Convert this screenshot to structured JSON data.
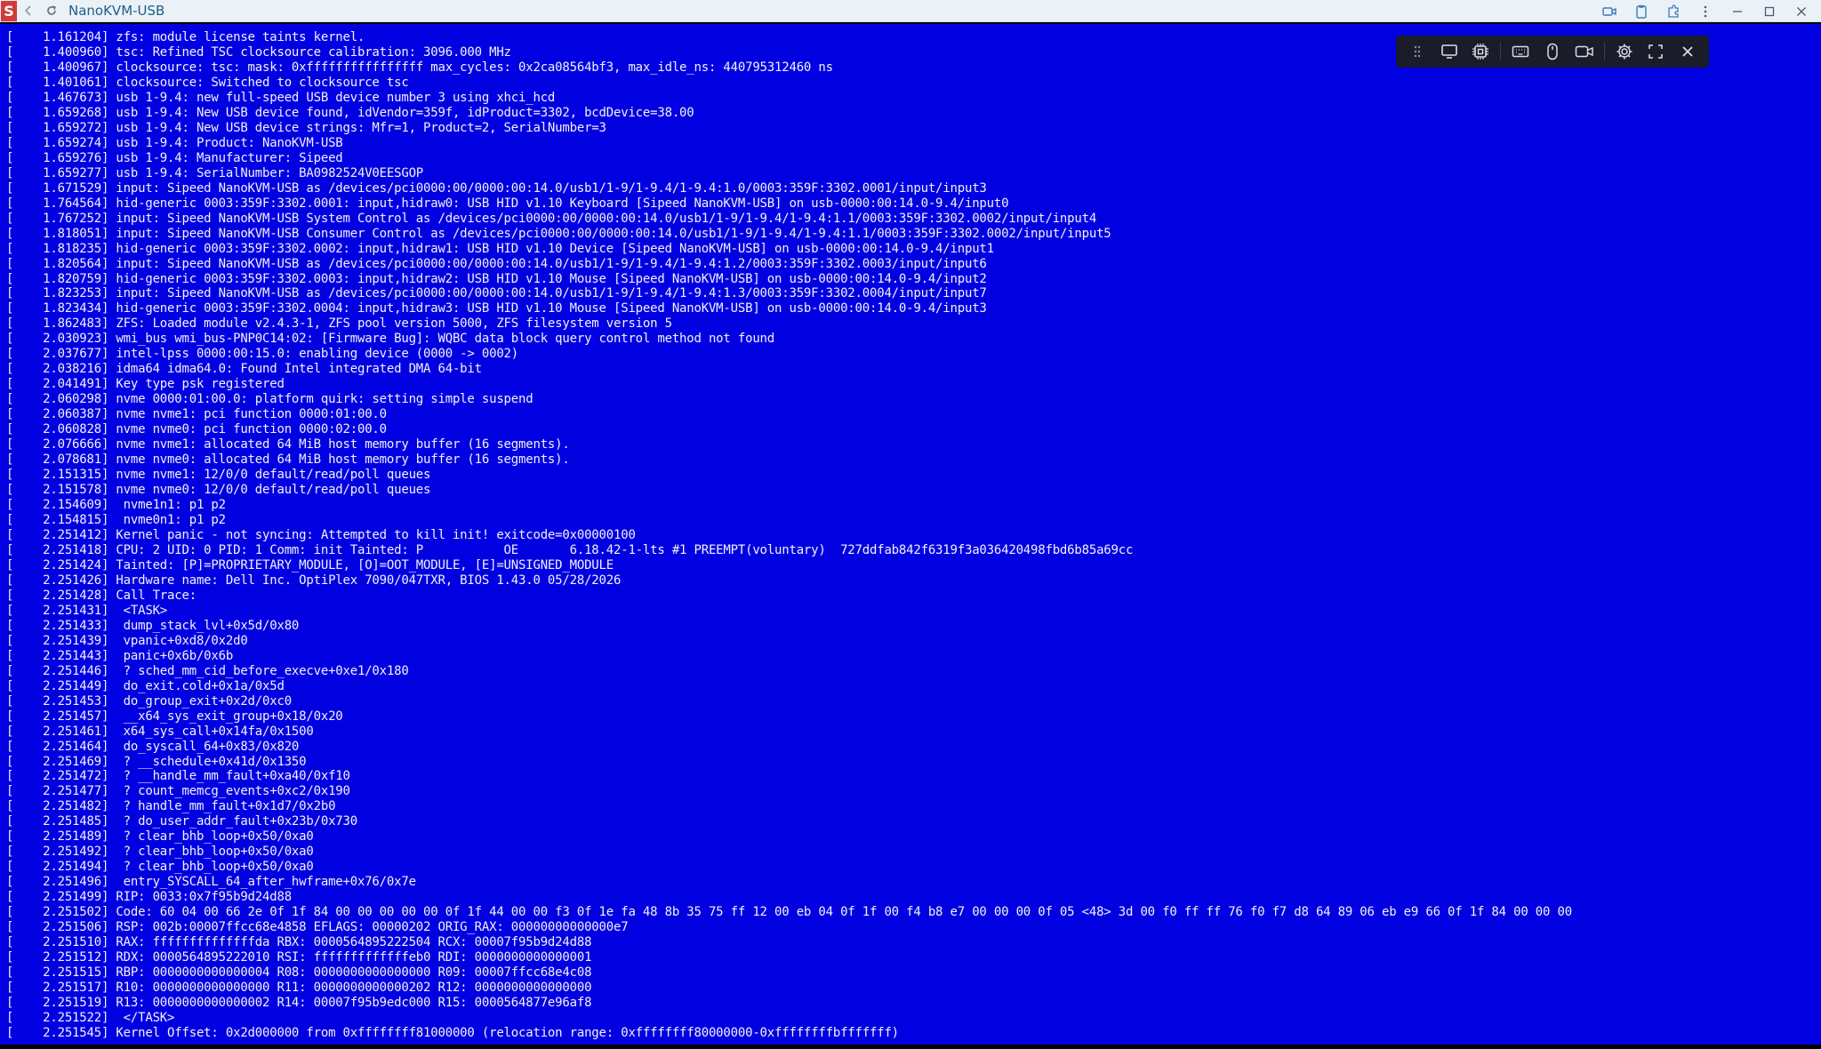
{
  "window": {
    "title": "NanoKVM-USB",
    "logo_letter": "S",
    "controls": [
      "back-icon",
      "refresh-icon"
    ],
    "right_controls": [
      "record-icon",
      "clipboard-icon",
      "extension-icon",
      "more-icon",
      "minimize-icon",
      "maximize-icon",
      "close-icon"
    ]
  },
  "toolbar": {
    "items": [
      "drag-handle-icon",
      "monitor-icon",
      "chip-icon",
      "keyboard-icon",
      "mouse-icon",
      "video-icon",
      "settings-icon",
      "fullscreen-icon",
      "close-icon"
    ]
  },
  "colors": {
    "console_bg": "#0000e0",
    "console_fg": "#f2f2ff",
    "titlebar_bg": "#eaf2f8",
    "toolbar_bg": "#1b1c2a"
  },
  "console": {
    "lines": [
      "[    1.161204] zfs: module license taints kernel.",
      "[    1.400960] tsc: Refined TSC clocksource calibration: 3096.000 MHz",
      "[    1.400967] clocksource: tsc: mask: 0xffffffffffffffff max_cycles: 0x2ca08564bf3, max_idle_ns: 440795312460 ns",
      "[    1.401061] clocksource: Switched to clocksource tsc",
      "[    1.467673] usb 1-9.4: new full-speed USB device number 3 using xhci_hcd",
      "[    1.659268] usb 1-9.4: New USB device found, idVendor=359f, idProduct=3302, bcdDevice=38.00",
      "[    1.659272] usb 1-9.4: New USB device strings: Mfr=1, Product=2, SerialNumber=3",
      "[    1.659274] usb 1-9.4: Product: NanoKVM-USB",
      "[    1.659276] usb 1-9.4: Manufacturer: Sipeed",
      "[    1.659277] usb 1-9.4: SerialNumber: BA0982524V0EESGOP",
      "[    1.671529] input: Sipeed NanoKVM-USB as /devices/pci0000:00/0000:00:14.0/usb1/1-9/1-9.4/1-9.4:1.0/0003:359F:3302.0001/input/input3",
      "[    1.764564] hid-generic 0003:359F:3302.0001: input,hidraw0: USB HID v1.10 Keyboard [Sipeed NanoKVM-USB] on usb-0000:00:14.0-9.4/input0",
      "[    1.767252] input: Sipeed NanoKVM-USB System Control as /devices/pci0000:00/0000:00:14.0/usb1/1-9/1-9.4/1-9.4:1.1/0003:359F:3302.0002/input/input4",
      "[    1.818051] input: Sipeed NanoKVM-USB Consumer Control as /devices/pci0000:00/0000:00:14.0/usb1/1-9/1-9.4/1-9.4:1.1/0003:359F:3302.0002/input/input5",
      "[    1.818235] hid-generic 0003:359F:3302.0002: input,hidraw1: USB HID v1.10 Device [Sipeed NanoKVM-USB] on usb-0000:00:14.0-9.4/input1",
      "[    1.820564] input: Sipeed NanoKVM-USB as /devices/pci0000:00/0000:00:14.0/usb1/1-9/1-9.4/1-9.4:1.2/0003:359F:3302.0003/input/input6",
      "[    1.820759] hid-generic 0003:359F:3302.0003: input,hidraw2: USB HID v1.10 Mouse [Sipeed NanoKVM-USB] on usb-0000:00:14.0-9.4/input2",
      "[    1.823253] input: Sipeed NanoKVM-USB as /devices/pci0000:00/0000:00:14.0/usb1/1-9/1-9.4/1-9.4:1.3/0003:359F:3302.0004/input/input7",
      "[    1.823434] hid-generic 0003:359F:3302.0004: input,hidraw3: USB HID v1.10 Mouse [Sipeed NanoKVM-USB] on usb-0000:00:14.0-9.4/input3",
      "[    1.862483] ZFS: Loaded module v2.4.3-1, ZFS pool version 5000, ZFS filesystem version 5",
      "[    2.030923] wmi_bus wmi_bus-PNP0C14:02: [Firmware Bug]: WQBC data block query control method not found",
      "[    2.037677] intel-lpss 0000:00:15.0: enabling device (0000 -> 0002)",
      "[    2.038216] idma64 idma64.0: Found Intel integrated DMA 64-bit",
      "[    2.041491] Key type psk registered",
      "[    2.060298] nvme 0000:01:00.0: platform quirk: setting simple suspend",
      "[    2.060387] nvme nvme1: pci function 0000:01:00.0",
      "[    2.060828] nvme nvme0: pci function 0000:02:00.0",
      "[    2.076666] nvme nvme1: allocated 64 MiB host memory buffer (16 segments).",
      "[    2.078681] nvme nvme0: allocated 64 MiB host memory buffer (16 segments).",
      "[    2.151315] nvme nvme1: 12/0/0 default/read/poll queues",
      "[    2.151578] nvme nvme0: 12/0/0 default/read/poll queues",
      "[    2.154609]  nvme1n1: p1 p2",
      "[    2.154815]  nvme0n1: p1 p2",
      "[    2.251412] Kernel panic - not syncing: Attempted to kill init! exitcode=0x00000100",
      "[    2.251418] CPU: 2 UID: 0 PID: 1 Comm: init Tainted: P           OE       6.18.42-1-lts #1 PREEMPT(voluntary)  727ddfab842f6319f3a036420498fbd6b85a69cc",
      "[    2.251424] Tainted: [P]=PROPRIETARY_MODULE, [O]=OOT_MODULE, [E]=UNSIGNED_MODULE",
      "[    2.251426] Hardware name: Dell Inc. OptiPlex 7090/047TXR, BIOS 1.43.0 05/28/2026",
      "[    2.251428] Call Trace:",
      "[    2.251431]  <TASK>",
      "[    2.251433]  dump_stack_lvl+0x5d/0x80",
      "[    2.251439]  vpanic+0xd8/0x2d0",
      "[    2.251443]  panic+0x6b/0x6b",
      "[    2.251446]  ? sched_mm_cid_before_execve+0xe1/0x180",
      "[    2.251449]  do_exit.cold+0x1a/0x5d",
      "[    2.251453]  do_group_exit+0x2d/0xc0",
      "[    2.251457]  __x64_sys_exit_group+0x18/0x20",
      "[    2.251461]  x64_sys_call+0x14fa/0x1500",
      "[    2.251464]  do_syscall_64+0x83/0x820",
      "[    2.251469]  ? __schedule+0x41d/0x1350",
      "[    2.251472]  ? __handle_mm_fault+0xa40/0xf10",
      "[    2.251477]  ? count_memcg_events+0xc2/0x190",
      "[    2.251482]  ? handle_mm_fault+0x1d7/0x2b0",
      "[    2.251485]  ? do_user_addr_fault+0x23b/0x730",
      "[    2.251489]  ? clear_bhb_loop+0x50/0xa0",
      "[    2.251492]  ? clear_bhb_loop+0x50/0xa0",
      "[    2.251494]  ? clear_bhb_loop+0x50/0xa0",
      "[    2.251496]  entry_SYSCALL_64_after_hwframe+0x76/0x7e",
      "[    2.251499] RIP: 0033:0x7f95b9d24d88",
      "[    2.251502] Code: 60 04 00 66 2e 0f 1f 84 00 00 00 00 00 0f 1f 44 00 00 f3 0f 1e fa 48 8b 35 75 ff 12 00 eb 04 0f 1f 00 f4 b8 e7 00 00 00 0f 05 <48> 3d 00 f0 ff ff 76 f0 f7 d8 64 89 06 eb e9 66 0f 1f 84 00 00 00",
      "[    2.251506] RSP: 002b:00007ffcc68e4858 EFLAGS: 00000202 ORIG_RAX: 00000000000000e7",
      "[    2.251510] RAX: ffffffffffffffda RBX: 0000564895222504 RCX: 00007f95b9d24d88",
      "[    2.251512] RDX: 0000564895222010 RSI: fffffffffffffeb0 RDI: 0000000000000001",
      "[    2.251515] RBP: 0000000000000004 R08: 0000000000000000 R09: 00007ffcc68e4c08",
      "[    2.251517] R10: 0000000000000000 R11: 0000000000000202 R12: 0000000000000000",
      "[    2.251519] R13: 0000000000000002 R14: 00007f95b9edc000 R15: 0000564877e96af8",
      "[    2.251522]  </TASK>",
      "[    2.251545] Kernel Offset: 0x2d000000 from 0xffffffff81000000 (relocation range: 0xffffffff80000000-0xffffffffbfffffff)"
    ]
  }
}
